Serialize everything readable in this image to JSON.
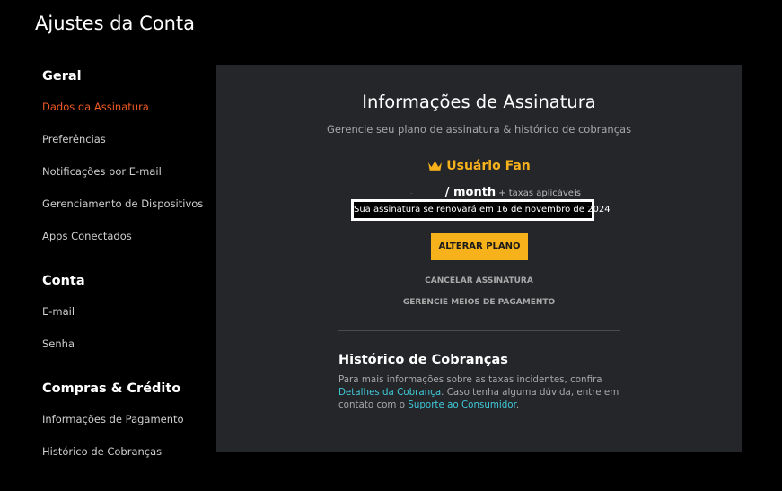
{
  "page": {
    "title": "Ajustes da Conta"
  },
  "sidebar": {
    "sections": [
      {
        "heading": "Geral",
        "items": [
          {
            "label": "Dados da Assinatura",
            "active": true
          },
          {
            "label": "Preferências"
          },
          {
            "label": "Notificações por E-mail"
          },
          {
            "label": "Gerenciamento de Dispositivos"
          },
          {
            "label": "Apps Conectados"
          }
        ]
      },
      {
        "heading": "Conta",
        "items": [
          {
            "label": "E-mail"
          },
          {
            "label": "Senha"
          }
        ]
      },
      {
        "heading": "Compras & Crédito",
        "items": [
          {
            "label": "Informações de Pagamento"
          },
          {
            "label": "Histórico de Cobranças"
          }
        ]
      }
    ]
  },
  "subscription": {
    "title": "Informações de Assinatura",
    "subtitle": "Gerencie seu plano de assinatura & histórico de cobranças",
    "plan_name": "Usuário Fan",
    "plan_icon": "crown-icon",
    "price_period": "/ month",
    "price_taxes": "+ taxas aplicáveis",
    "renewal_text": "Sua assinatura se renovará em 16 de novembro de 2024",
    "change_plan_label": "ALTERAR PLANO",
    "cancel_label": "CANCELAR ASSINATURA",
    "payment_methods_label": "GERENCIE MEIOS DE PAGAMENTO"
  },
  "billing_history": {
    "title": "Histórico de Cobranças",
    "text_before": "Para mais informações sobre as taxas incidentes, confira ",
    "link_details": "Detalhes da Cobrança",
    "text_middle": ". Caso tenha alguma dúvida, entre em contato com o ",
    "link_support": "Suporte ao Consumidor",
    "text_after": "."
  },
  "colors": {
    "accent_orange": "#f15a24",
    "plan_gold": "#f7b21b",
    "link_teal": "#3fc8d8",
    "panel_bg": "#25262a"
  }
}
